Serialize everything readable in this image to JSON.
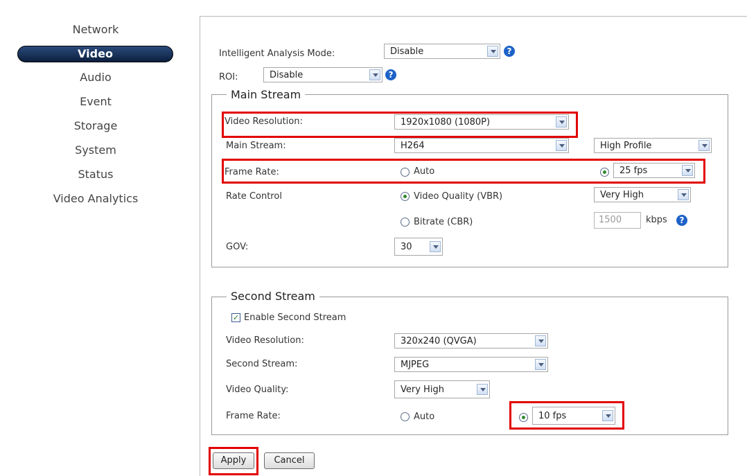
{
  "sidebar": {
    "items": [
      {
        "label": "Network"
      },
      {
        "label": "Video"
      },
      {
        "label": "Audio"
      },
      {
        "label": "Event"
      },
      {
        "label": "Storage"
      },
      {
        "label": "System"
      },
      {
        "label": "Status"
      },
      {
        "label": "Video Analytics"
      }
    ],
    "active": "Video"
  },
  "top": {
    "ia_label": "Intelligent Analysis Mode:",
    "ia_value": "Disable",
    "roi_label": "ROI:",
    "roi_value": "Disable",
    "help_glyph": "?"
  },
  "main_stream": {
    "legend": "Main Stream",
    "resolution_label": "Video Resolution:",
    "resolution_value": "1920x1080 (1080P)",
    "stream_label": "Main Stream:",
    "codec_value": "H264",
    "profile_value": "High Profile",
    "frame_rate_label": "Frame Rate:",
    "auto_label": "Auto",
    "fps_value": "25 fps",
    "rate_control_label": "Rate Control",
    "vbr_label": "Video Quality (VBR)",
    "vbr_quality_value": "Very High",
    "cbr_label": "Bitrate (CBR)",
    "bitrate_value": "1500",
    "bitrate_unit": "kbps",
    "gov_label": "GOV:",
    "gov_value": "30"
  },
  "second_stream": {
    "legend": "Second Stream",
    "enable_label": "Enable Second Stream",
    "enable_checked": true,
    "resolution_label": "Video Resolution:",
    "resolution_value": "320x240 (QVGA)",
    "stream_label": "Second Stream:",
    "codec_value": "MJPEG",
    "quality_label": "Video Quality:",
    "quality_value": "Very High",
    "frame_rate_label": "Frame Rate:",
    "auto_label": "Auto",
    "fps_value": "10 fps"
  },
  "buttons": {
    "apply": "Apply",
    "cancel": "Cancel"
  },
  "colors": {
    "highlight": "#e20000",
    "nav_active": "#0c1f3f",
    "help_icon": "#1d62c8"
  }
}
